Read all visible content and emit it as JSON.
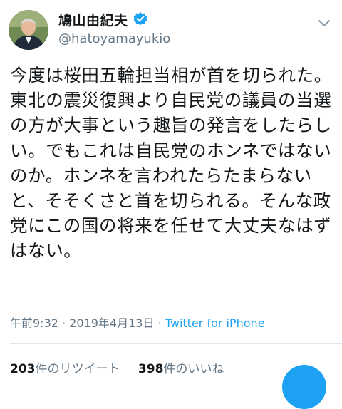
{
  "user": {
    "display_name": "鳩山由紀夫",
    "handle": "@hatoyamayukio"
  },
  "tweet": {
    "text": "今度は桜田五輪担当相が首を切られた。東北の震災復興より自民党の議員の当選の方が大事という趣旨の発言をしたらしい。でもこれは自民党のホンネではないのか。ホンネを言われたらたまらないと、そそくさと首を切られる。そんな政党にこの国の将来を任せて大丈夫なはずはない。",
    "time": "午前9:32",
    "separator1": " · ",
    "date": "2019年4月13日",
    "separator2": " · ",
    "source": "Twitter for iPhone"
  },
  "stats": {
    "retweets_count": "203",
    "retweets_label": "件のリツイート",
    "likes_count": "398",
    "likes_label": "件のいいね"
  },
  "colors": {
    "accent": "#1da1f2",
    "secondary_text": "#657786",
    "primary_text": "#14171a"
  },
  "icons": {
    "verified": "verified-badge-icon",
    "more": "chevron-down-icon",
    "compose": "compose-fab"
  }
}
